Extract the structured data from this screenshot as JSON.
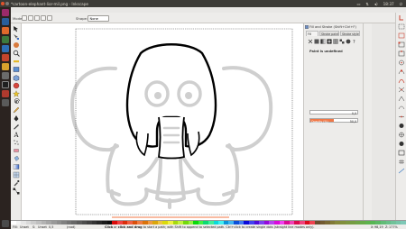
{
  "window": {
    "title": "*cartoon-elephant-lior-mil.png - Inkscape",
    "clock": "18:37"
  },
  "tool_controls": {
    "mode_label": "Mode:",
    "shape_label": "Shape:",
    "shape_value": "None"
  },
  "dock": {
    "title": "Fill and Stroke (Shift+Ctrl+F)",
    "tabs": [
      "Fill",
      "Stroke paint",
      "Stroke style"
    ],
    "paint_status": "Paint is undefined",
    "blur_label": "Blur (%)",
    "blur_value": "0,0",
    "opacity_label": "Opacity (%)",
    "opacity_value": "50,0",
    "opacity_level": 0.5
  },
  "status": {
    "fill_label": "Fill:",
    "fill_value": "Unset",
    "stroke_label": "S:",
    "stroke_value": "Unset",
    "stroke_width": "0,5",
    "layer": "(root)",
    "message_strong": "Click",
    "message_mid": "or",
    "message_strong2": "click and drag",
    "message_rest": "to start a path; with Shift to append to selected path. Ctrl+click to create single dots (straight line modes only).",
    "x_label": "X:",
    "x_value": "98,19",
    "y_label": "Y:",
    "y_value": "188,27",
    "zoom_label": "Z:",
    "zoom_value": "177%"
  },
  "colors": {
    "accent": "#f07746",
    "launcher_bg": "#2b2320",
    "topbar_bg": "#3c3b37"
  },
  "icons": {
    "close": "close-icon",
    "minimize": "minimize-icon",
    "maximize": "maximize-icon"
  }
}
